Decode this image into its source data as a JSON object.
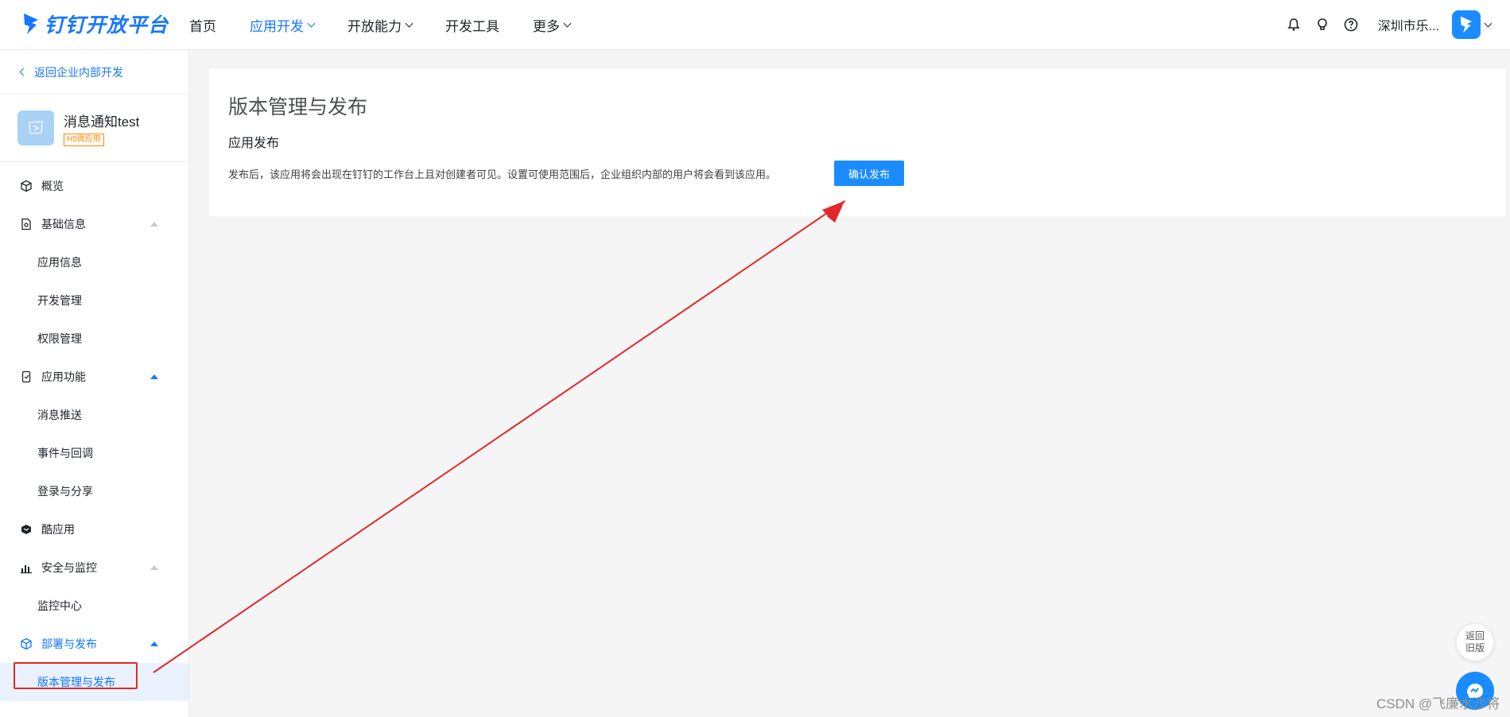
{
  "header": {
    "logo_text": "钉钉开放平台",
    "nav": [
      {
        "label": "首页"
      },
      {
        "label": "应用开发"
      },
      {
        "label": "开放能力"
      },
      {
        "label": "开发工具"
      },
      {
        "label": "更多"
      }
    ],
    "org_name": "深圳市乐..."
  },
  "sidebar": {
    "back_label": "返回企业内部开发",
    "app_name": "消息通知test",
    "app_tag": "H5微应用",
    "items": [
      {
        "label": "概览"
      },
      {
        "label": "基础信息"
      },
      {
        "label": "应用信息"
      },
      {
        "label": "开发管理"
      },
      {
        "label": "权限管理"
      },
      {
        "label": "应用功能"
      },
      {
        "label": "消息推送"
      },
      {
        "label": "事件与回调"
      },
      {
        "label": "登录与分享"
      },
      {
        "label": "酷应用"
      },
      {
        "label": "安全与监控"
      },
      {
        "label": "监控中心"
      },
      {
        "label": "部署与发布"
      },
      {
        "label": "版本管理与发布"
      }
    ]
  },
  "main": {
    "title": "版本管理与发布",
    "section": "应用发布",
    "description": "发布后，该应用将会出现在钉钉的工作台上且对创建者可见。设置可使用范围后，企业组织内部的用户将会看到该应用。",
    "confirm_label": "确认发布"
  },
  "floating": {
    "old_version": "返回\n旧版"
  },
  "watermark": "CSDN @飞廉水沙将",
  "colors": {
    "accent": "#1677ff",
    "button": "#1a8cff",
    "annotation_red": "#e4262b"
  }
}
